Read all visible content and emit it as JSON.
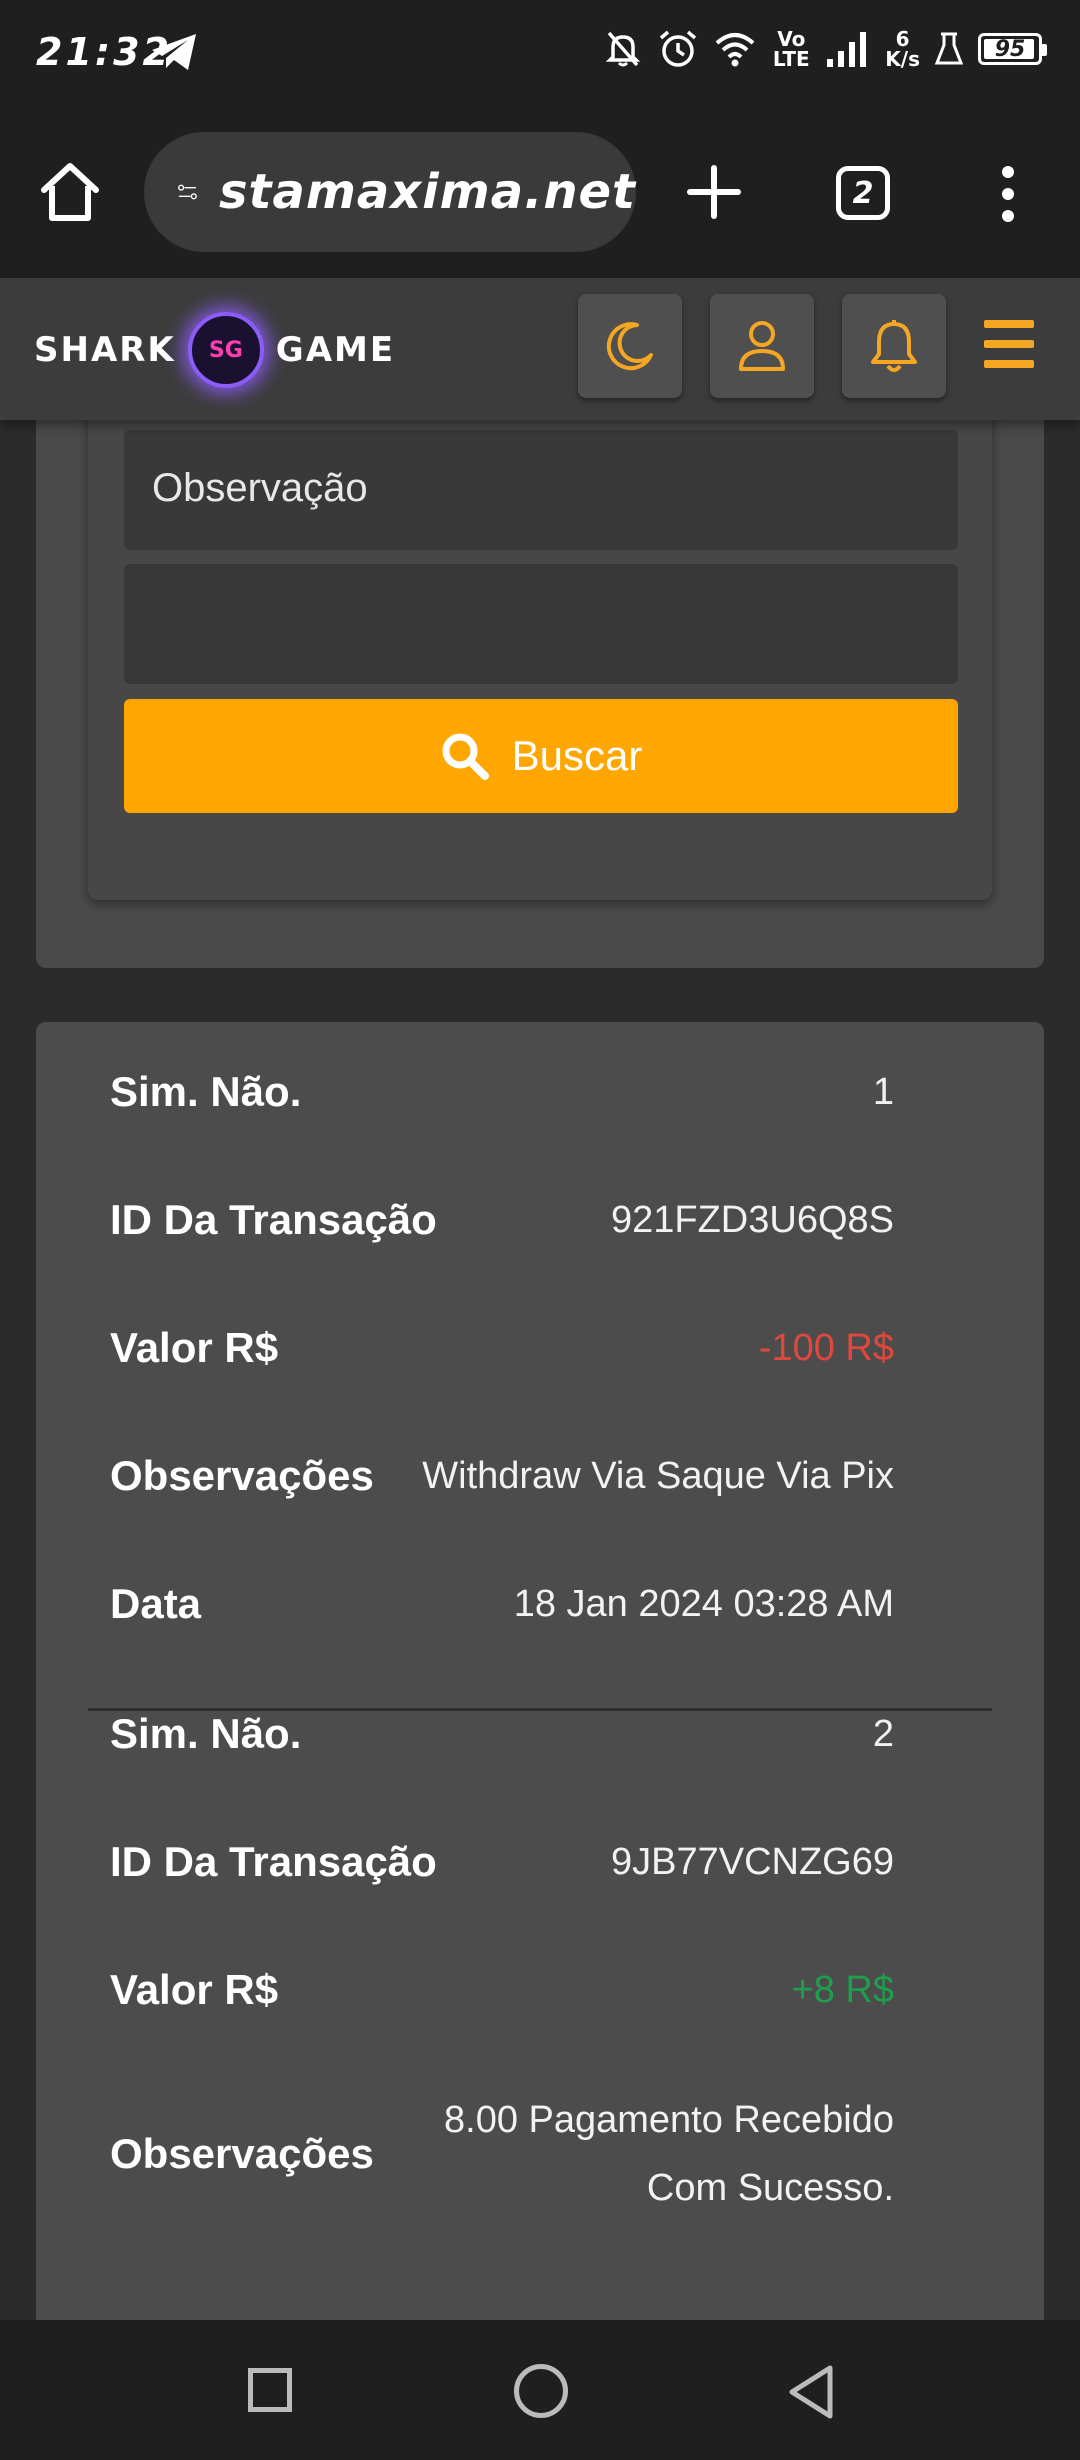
{
  "status_bar": {
    "time": "21:32",
    "network": "Vo LTE",
    "speed_value": "6",
    "speed_unit": "K/s",
    "battery": "95"
  },
  "browser": {
    "url": "stamaxima.net",
    "tab_count": "2"
  },
  "site": {
    "logo_left": "SHARK",
    "logo_badge": "SG",
    "logo_right": "GAME",
    "accent_color": "#f5a623"
  },
  "filter": {
    "observacao_placeholder": "Observação",
    "search_button_label": "Buscar"
  },
  "transactions": [
    {
      "sim_nao_label": "Sim. Não.",
      "sim_nao": "1",
      "id_label": "ID Da Transação",
      "id": "921FZD3U6Q8S",
      "valor_label": "Valor R$",
      "valor": "-100 R$",
      "obs_label": "Observações",
      "obs": "Withdraw Via Saque Via Pix",
      "data_label": "Data",
      "data": "18 Jan 2024 03:28 AM"
    },
    {
      "sim_nao_label": "Sim. Não.",
      "sim_nao": "2",
      "id_label": "ID Da Transação",
      "id": "9JB77VCNZG69",
      "valor_label": "Valor R$",
      "valor": "+8 R$",
      "obs_label": "Observações",
      "obs_line1": "8.00 Pagamento Recebido",
      "obs_line2": "Com Sucesso."
    }
  ],
  "colors": {
    "negative": "#e0483e",
    "positive": "#1f9e4e",
    "button": "#ffa600"
  }
}
